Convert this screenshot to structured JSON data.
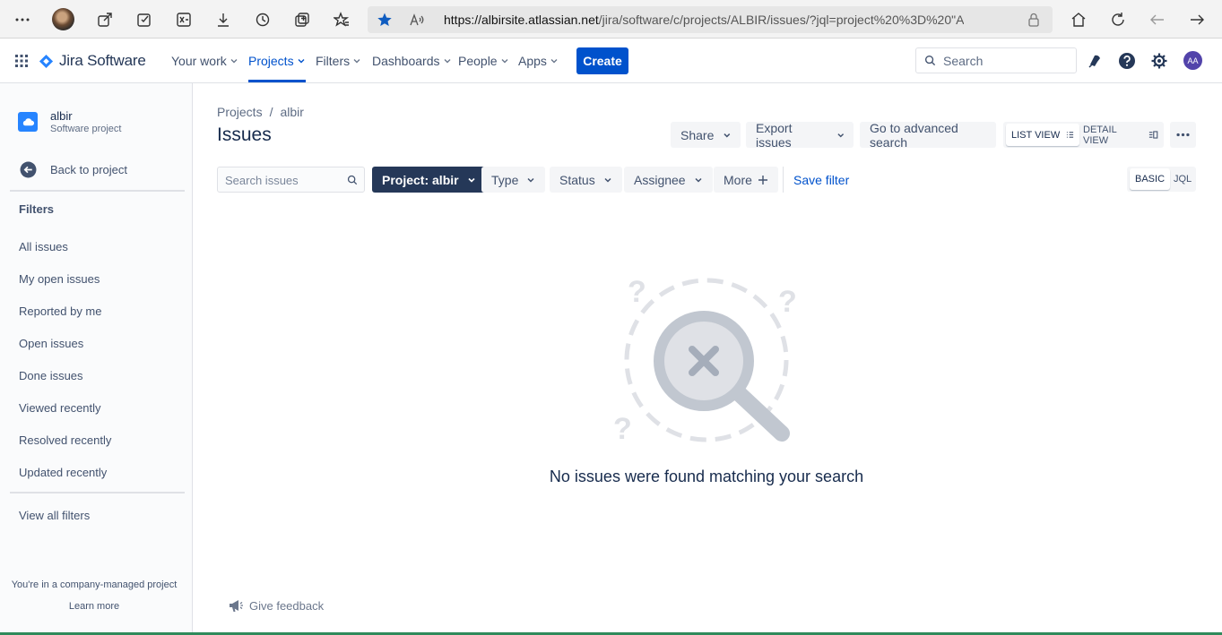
{
  "browser": {
    "url_host": "https://albirsite.atlassian.net",
    "url_rest": "/jira/software/c/projects/ALBIR/issues/?jql=project%20%3D%20\"ALBIR\"%..."
  },
  "topnav": {
    "product": "Jira Software",
    "items": [
      {
        "label": "Your work"
      },
      {
        "label": "Projects"
      },
      {
        "label": "Filters"
      },
      {
        "label": "Dashboards"
      },
      {
        "label": "People"
      },
      {
        "label": "Apps"
      }
    ],
    "create_label": "Create",
    "search_placeholder": "Search",
    "user_initials": "AA"
  },
  "sidebar": {
    "project_name": "albir",
    "project_type": "Software project",
    "back_label": "Back to project",
    "filters_heading": "Filters",
    "filters": [
      {
        "label": "All issues"
      },
      {
        "label": "My open issues"
      },
      {
        "label": "Reported by me"
      },
      {
        "label": "Open issues"
      },
      {
        "label": "Done issues"
      },
      {
        "label": "Viewed recently"
      },
      {
        "label": "Resolved recently"
      },
      {
        "label": "Updated recently"
      }
    ],
    "view_all_filters": "View all filters",
    "footer_text": "You're in a company-managed project",
    "learn_more": "Learn more"
  },
  "main": {
    "breadcrumb": {
      "root": "Projects",
      "sep": "/",
      "current": "albir"
    },
    "title": "Issues",
    "toolbar": {
      "share": "Share",
      "export": "Export issues",
      "advanced": "Go to advanced search",
      "list_view": "LIST VIEW",
      "detail_view": "DETAIL VIEW"
    },
    "filterbar": {
      "search_placeholder": "Search issues",
      "project_filter": "Project: albir",
      "type": "Type",
      "status": "Status",
      "assignee": "Assignee",
      "more": "More",
      "save_filter": "Save filter",
      "basic": "BASIC",
      "jql": "JQL"
    },
    "empty_message": "No issues were found matching your search",
    "feedback": "Give feedback"
  },
  "colors": {
    "accent": "#0052cc",
    "selected_filter": "#253858",
    "avatar": "#5243aa"
  }
}
